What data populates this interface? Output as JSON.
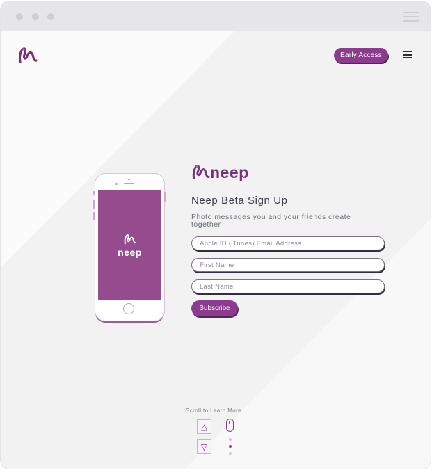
{
  "header": {
    "early_access_label": "Early Access"
  },
  "phone": {
    "screen_brand": "neep"
  },
  "signup": {
    "brand_word": "neep",
    "heading": "Neep Beta Sign Up",
    "subheading": "Photo messages you and your friends create together",
    "fields": {
      "apple_id_placeholder": "Apple ID (iTunes) Email Address",
      "first_name_placeholder": "First Name",
      "last_name_placeholder": "Last Name"
    },
    "subscribe_label": "Subscribe"
  },
  "scroll": {
    "label": "Scroll to Learn More",
    "up_glyph": "△",
    "down_glyph": "▽"
  },
  "colors": {
    "brand_purple": "#8d3b8f",
    "screen_purple": "#954c8f",
    "text_dark": "#3d3d4a"
  },
  "icons": {
    "logo": "neep-n-logo-icon",
    "menu": "hamburger-menu-icon",
    "scroll_up": "triangle-up-icon",
    "scroll_down": "triangle-down-icon",
    "mouse": "mouse-scroll-icon"
  }
}
